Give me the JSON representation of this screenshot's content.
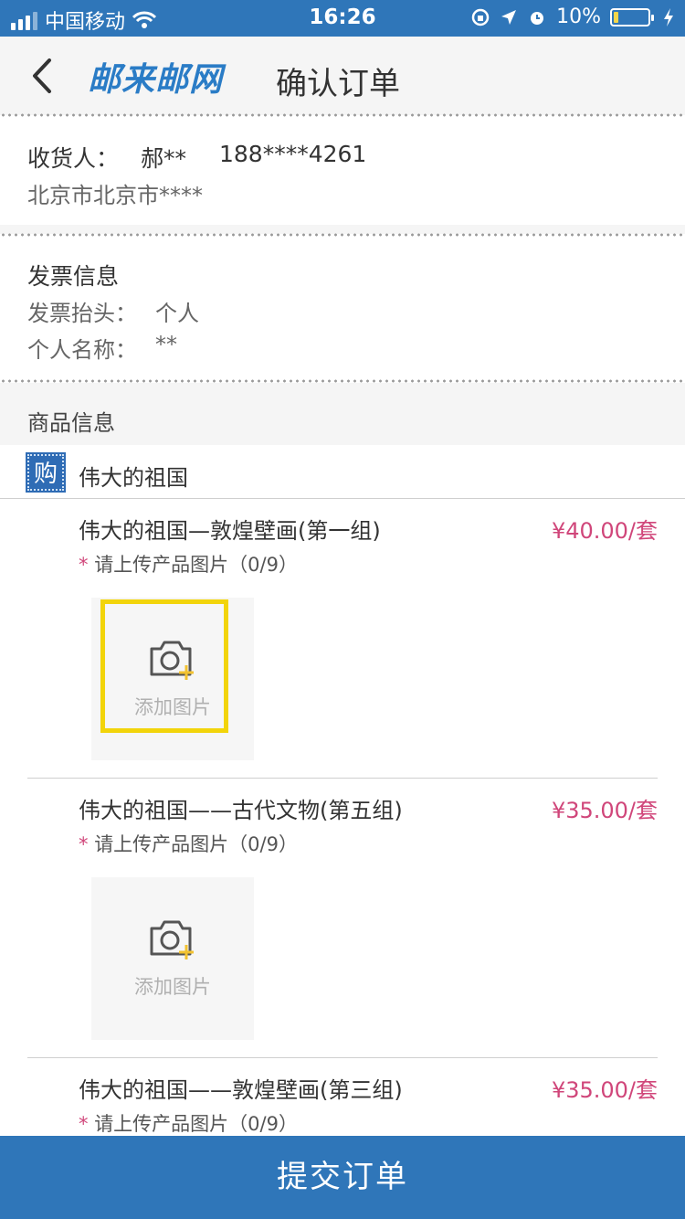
{
  "status_bar": {
    "carrier": "中国移动",
    "time": "16:26",
    "battery": "10%",
    "battery_level": 0.1
  },
  "header": {
    "logo_text": "邮来邮网",
    "title": "确认订单"
  },
  "address": {
    "receiver_label": "收货人：",
    "receiver_name": "郝**",
    "phone": "188****4261",
    "address": "北京市北京市****"
  },
  "invoice": {
    "heading": "发票信息",
    "title_label": "发票抬头：",
    "title_value": "个人",
    "name_label": "个人名称：",
    "name_value": "**"
  },
  "goods": {
    "heading": "商品信息",
    "shop_badge": "购",
    "shop_name": "伟大的祖国",
    "upload_label": "添加图片",
    "items": [
      {
        "name": "伟大的祖国—敦煌壁画(第一组)",
        "price": "¥40.00/套",
        "upload_hint": "请上传产品图片（0/9）"
      },
      {
        "name": "伟大的祖国——古代文物(第五组)",
        "price": "¥35.00/套",
        "upload_hint": "请上传产品图片（0/9）"
      },
      {
        "name": "伟大的祖国——敦煌壁画(第三组)",
        "price": "¥35.00/套",
        "upload_hint": "请上传产品图片（0/9）"
      }
    ]
  },
  "footer": {
    "submit_label": "提交订单"
  },
  "colors": {
    "brand_blue": "#2f76b9",
    "price_pink": "#d0467a",
    "highlight_yellow": "#f2d40a"
  }
}
